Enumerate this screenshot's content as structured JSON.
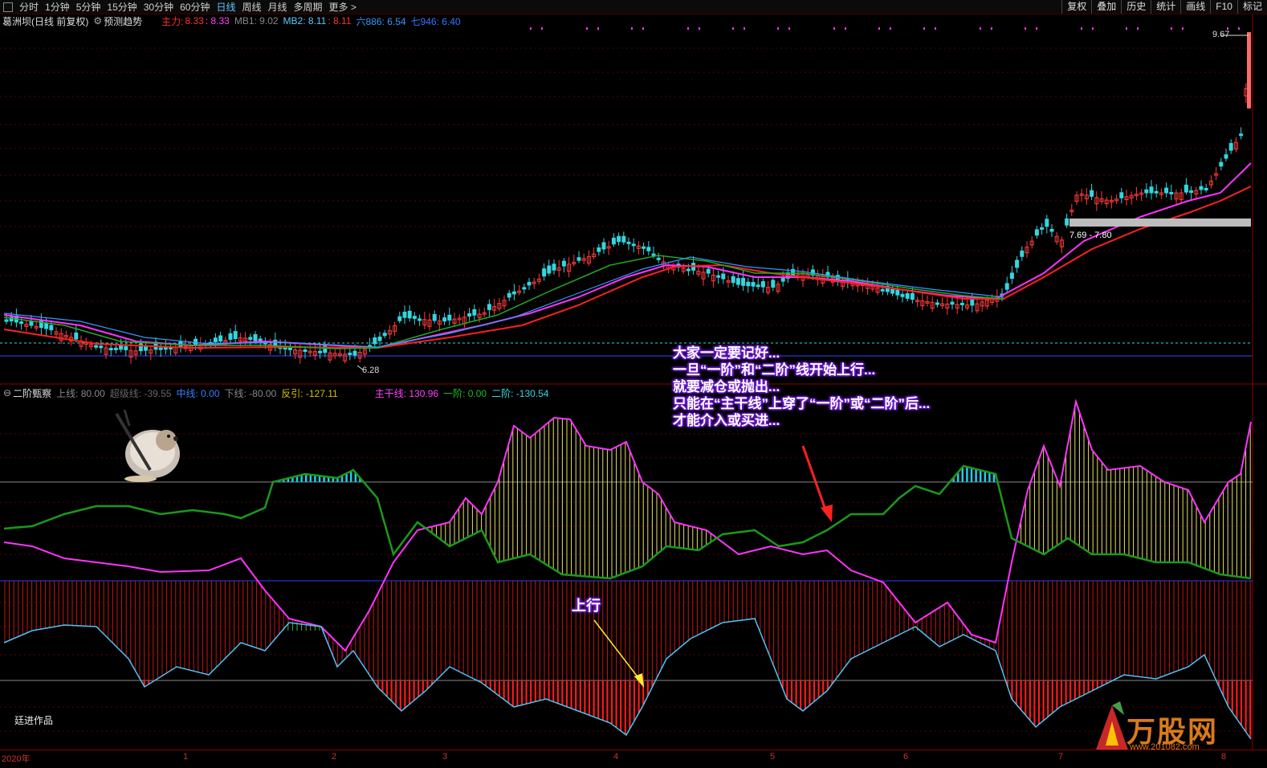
{
  "toolbar": {
    "periods": [
      "分时",
      "1分钟",
      "5分钟",
      "15分钟",
      "30分钟",
      "60分钟",
      "日线",
      "周线",
      "月线",
      "多周期",
      "更多 >"
    ],
    "active_period": "日线",
    "right_buttons": [
      "复权",
      "叠加",
      "历史",
      "统计",
      "画线",
      "F10",
      "标记"
    ]
  },
  "main_legend": {
    "title": "葛洲坝(日线 前复权)",
    "predict_label": "预测趋势",
    "zhuli_label": "主力:",
    "zhuli_v1": "8.33",
    "zhuli_v2": ": 8.33",
    "mb1": "MB1: 9.02",
    "mb2": "MB2: 8.11",
    "mb2b": ": 8.11",
    "liu": "六886: 6.54",
    "qi": "七946: 6.40"
  },
  "price_marks": {
    "high": "9.67",
    "low": "6.28",
    "band": "7.69 - 7.80"
  },
  "indicator_legend": {
    "title": "二阶甄察",
    "upper": "上线: 80.00",
    "gray": "超级线: -39.55",
    "mid": "中线: 0.00",
    "lower": "下线: -80.00",
    "rebound": "反引: -127.11",
    "main_line": "主干线: 130.96",
    "first": "一阶: 0.00",
    "second": "二阶: -130.54"
  },
  "annotations": {
    "lines": [
      "大家一定要记好...",
      "一旦“一阶”和“二阶”线开始上行...",
      "就要减仓或抛出...",
      "只能在“主干线”上穿了“一阶”或“二阶”后...",
      "才能介入或买进..."
    ],
    "up_label": "上行"
  },
  "author": "廷进作品",
  "watermark": {
    "name": "万股网",
    "url": "www.201082.com"
  },
  "x_axis": [
    "2020年",
    "1",
    "2",
    "3",
    "4",
    "5",
    "6",
    "7",
    "8"
  ],
  "colors": {
    "up": "#ff3b3b",
    "down": "#33d6e0",
    "ma_red": "#ff2020",
    "ma_pink": "#ff33ff",
    "ma_green": "#22aa22",
    "ma_blue": "#3399ff"
  }
}
